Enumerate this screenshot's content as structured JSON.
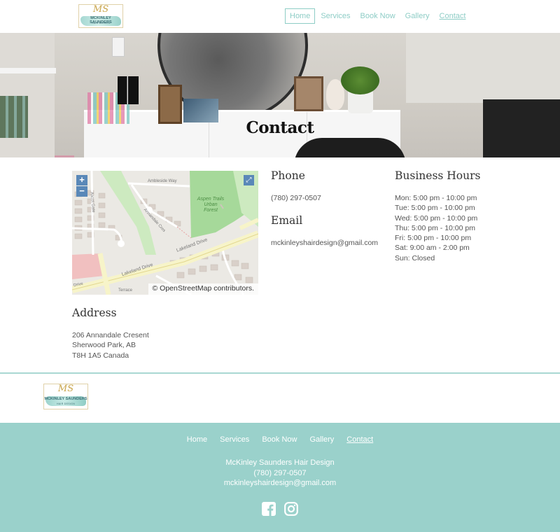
{
  "brand": {
    "monogram": "MS",
    "name": "MCKINLEY SAUNDERS",
    "tagline": "HAIR DESIGN"
  },
  "nav": {
    "items": [
      {
        "label": "Home",
        "state": "active"
      },
      {
        "label": "Services",
        "state": ""
      },
      {
        "label": "Book Now",
        "state": ""
      },
      {
        "label": "Gallery",
        "state": ""
      },
      {
        "label": "Contact",
        "state": "current"
      }
    ]
  },
  "hero": {
    "title": "Contact"
  },
  "map": {
    "zoom_in": "+",
    "zoom_out": "−",
    "attribution": "© OpenStreetMap contributors.",
    "labels": {
      "street1": "Ambleside Way",
      "street2": "Lakeland Drive",
      "street3": "Lakeland Drive",
      "street4": "Annandale Cres",
      "street5": "Ascot Gate",
      "forest": "Aspen Trails Urban Forest",
      "terrace": "Terrace",
      "drive": "Drive"
    }
  },
  "phone": {
    "heading": "Phone",
    "value": "(780) 297-0507"
  },
  "email": {
    "heading": "Email",
    "value": "mckinleyshairdesign@gmail.com"
  },
  "hours": {
    "heading": "Business Hours",
    "rows": [
      "Mon: 5:00 pm - 10:00 pm",
      "Tue: 5:00 pm - 10:00 pm",
      "Wed: 5:00 pm - 10:00 pm",
      "Thu: 5:00 pm - 10:00 pm",
      "Fri: 5:00 pm - 10:00 pm",
      "Sat: 9:00 am - 2:00 pm",
      "Sun: Closed"
    ]
  },
  "address": {
    "heading": "Address",
    "line1": "206 Annandale Cresent",
    "line2": "Sherwood Park, AB",
    "line3": "T8H 1A5 Canada"
  },
  "footer": {
    "nav": [
      {
        "label": "Home",
        "state": ""
      },
      {
        "label": "Services",
        "state": ""
      },
      {
        "label": "Book Now",
        "state": ""
      },
      {
        "label": "Gallery",
        "state": ""
      },
      {
        "label": "Contact",
        "state": "current"
      }
    ],
    "business_name": "McKinley Saunders Hair Design",
    "phone": "(780) 297-0507",
    "email": "mckinleyshairdesign@gmail.com",
    "social": [
      {
        "icon": "facebook-icon"
      },
      {
        "icon": "instagram-icon"
      }
    ]
  },
  "colors": {
    "accent": "#8ecdc6",
    "footer_bg": "#9ad1cb",
    "divider": "#a9d8d2"
  }
}
